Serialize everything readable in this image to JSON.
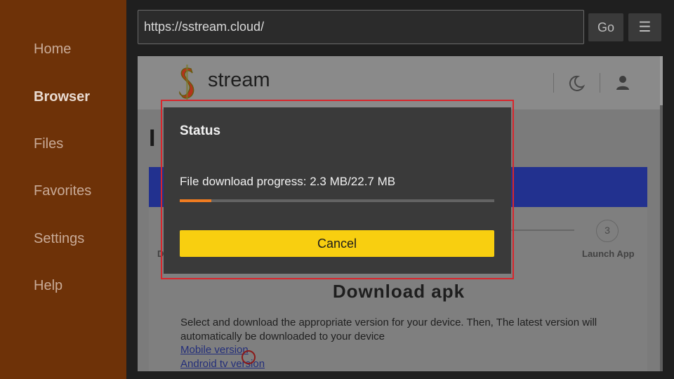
{
  "sidebar": {
    "items": [
      {
        "label": "Home",
        "active": false
      },
      {
        "label": "Browser",
        "active": true
      },
      {
        "label": "Files",
        "active": false
      },
      {
        "label": "Favorites",
        "active": false
      },
      {
        "label": "Settings",
        "active": false
      },
      {
        "label": "Help",
        "active": false
      }
    ]
  },
  "topbar": {
    "url": "https://sstream.cloud/",
    "go_label": "Go",
    "menu_icon": "☰"
  },
  "site": {
    "name": "stream",
    "logo_letter": "S",
    "heading_partial": "I",
    "step3_number": "3",
    "step3_label": "Launch App",
    "step1_label_partial": "D",
    "download_heading": "Download apk",
    "download_desc": "Select and download the appropriate version for your device. Then, The latest version will automatically be downloaded to your device",
    "links": [
      "Mobile version",
      "Android tv version"
    ]
  },
  "dialog": {
    "title": "Status",
    "progress_text": "File download progress: 2.3 MB/22.7 MB",
    "progress_fraction": 0.101,
    "cancel_label": "Cancel"
  },
  "colors": {
    "sidebar_bg": "#6e3208",
    "accent_progress": "#f07c21",
    "cancel_button": "#f8cf10",
    "dialog_outline": "#d8262c",
    "site_band": "#22318f"
  }
}
